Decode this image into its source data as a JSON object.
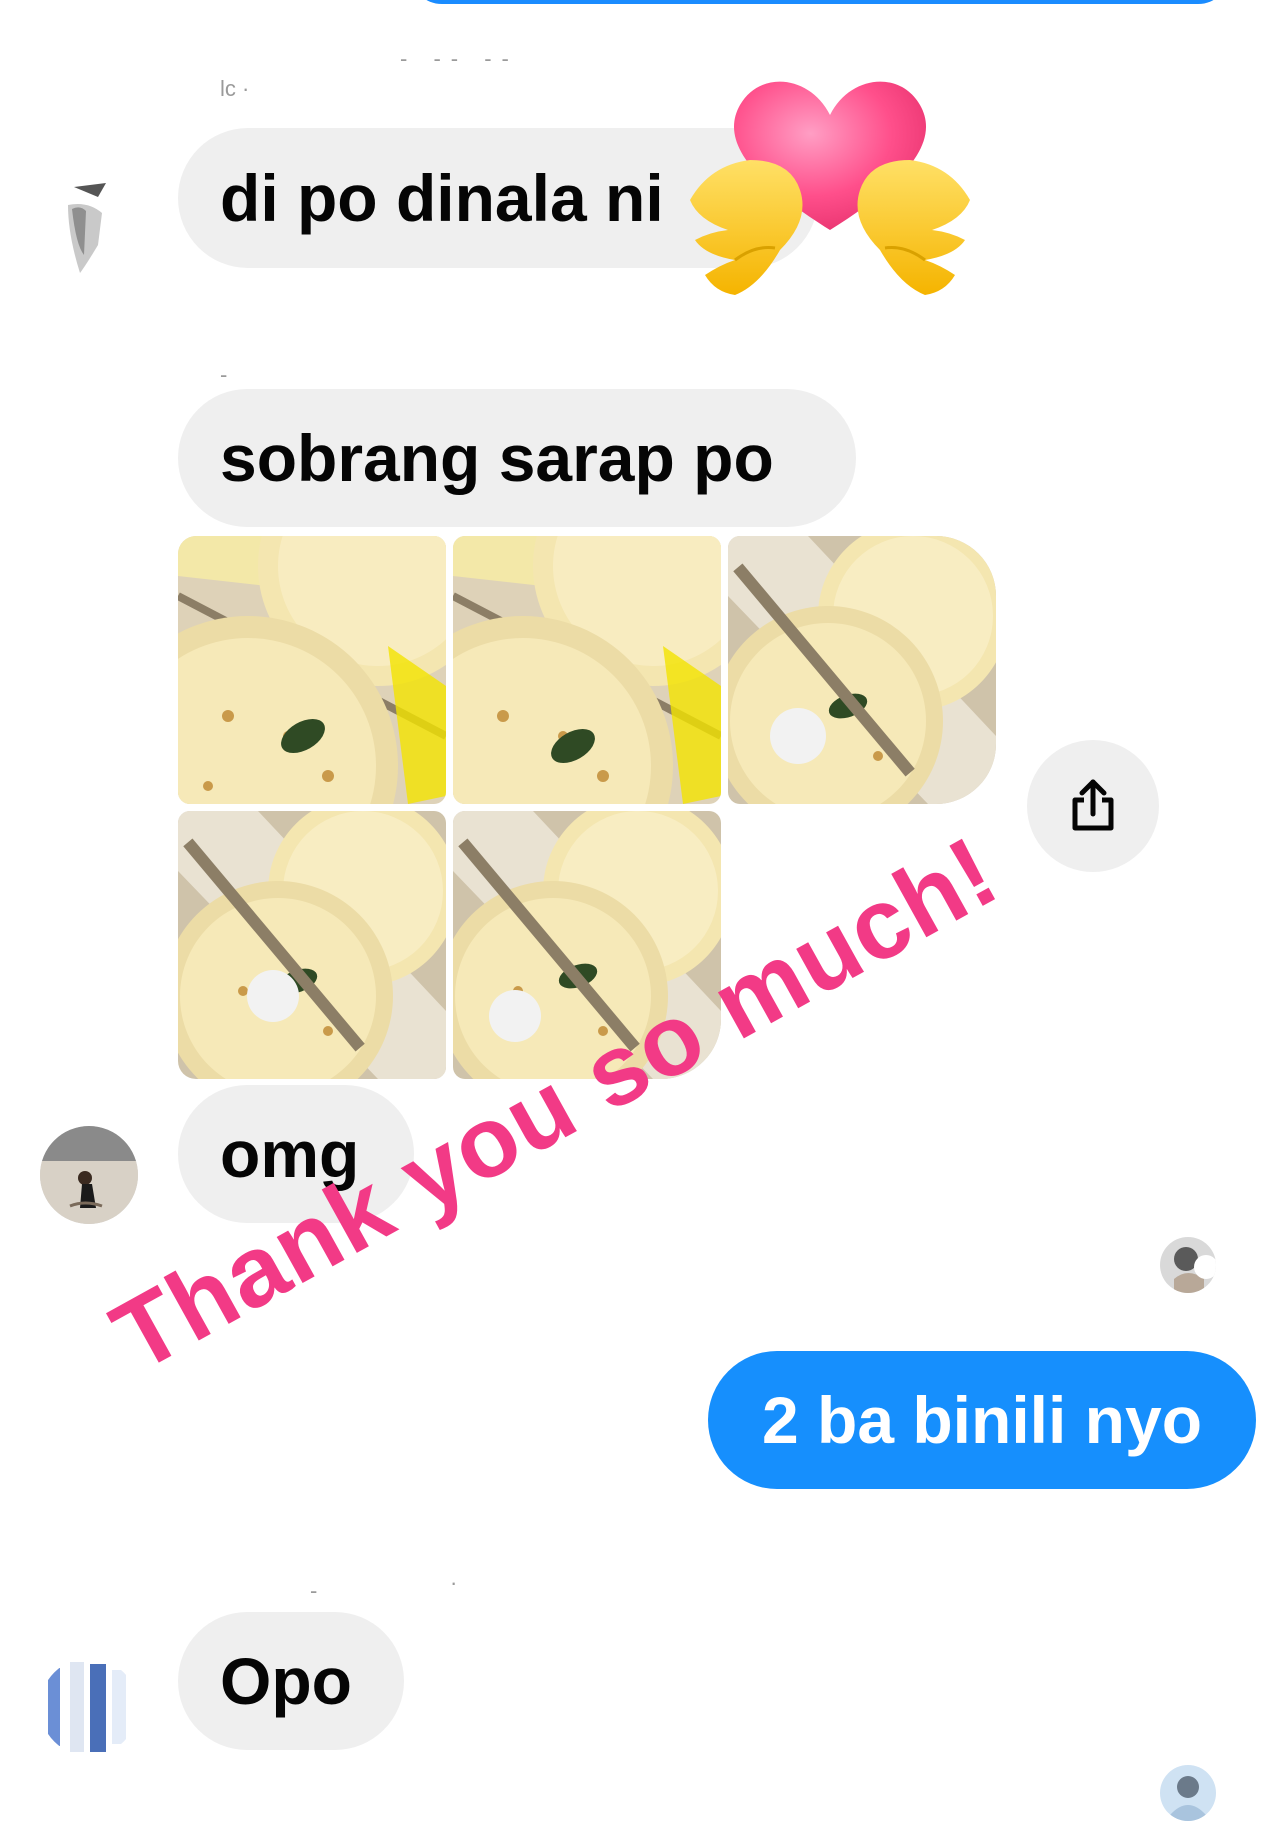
{
  "messages": {
    "msg1": "di po dinala ni",
    "msg2": "sobrang sarap po",
    "msg3": "omg",
    "msg4": "2 ba binili nyo",
    "msg5": "Opo"
  },
  "overlay": {
    "thanks_text": "Thank you so much!",
    "sticker": "heart-hands-emoji"
  },
  "icons": {
    "share": "share-icon",
    "avatar": "avatar-icon"
  },
  "colors": {
    "incoming_bubble": "#efefef",
    "outgoing_bubble": "#168ffd",
    "thanks_text": "#f23a86",
    "heart": "#ff4f8b",
    "hands": "#ffc933"
  }
}
